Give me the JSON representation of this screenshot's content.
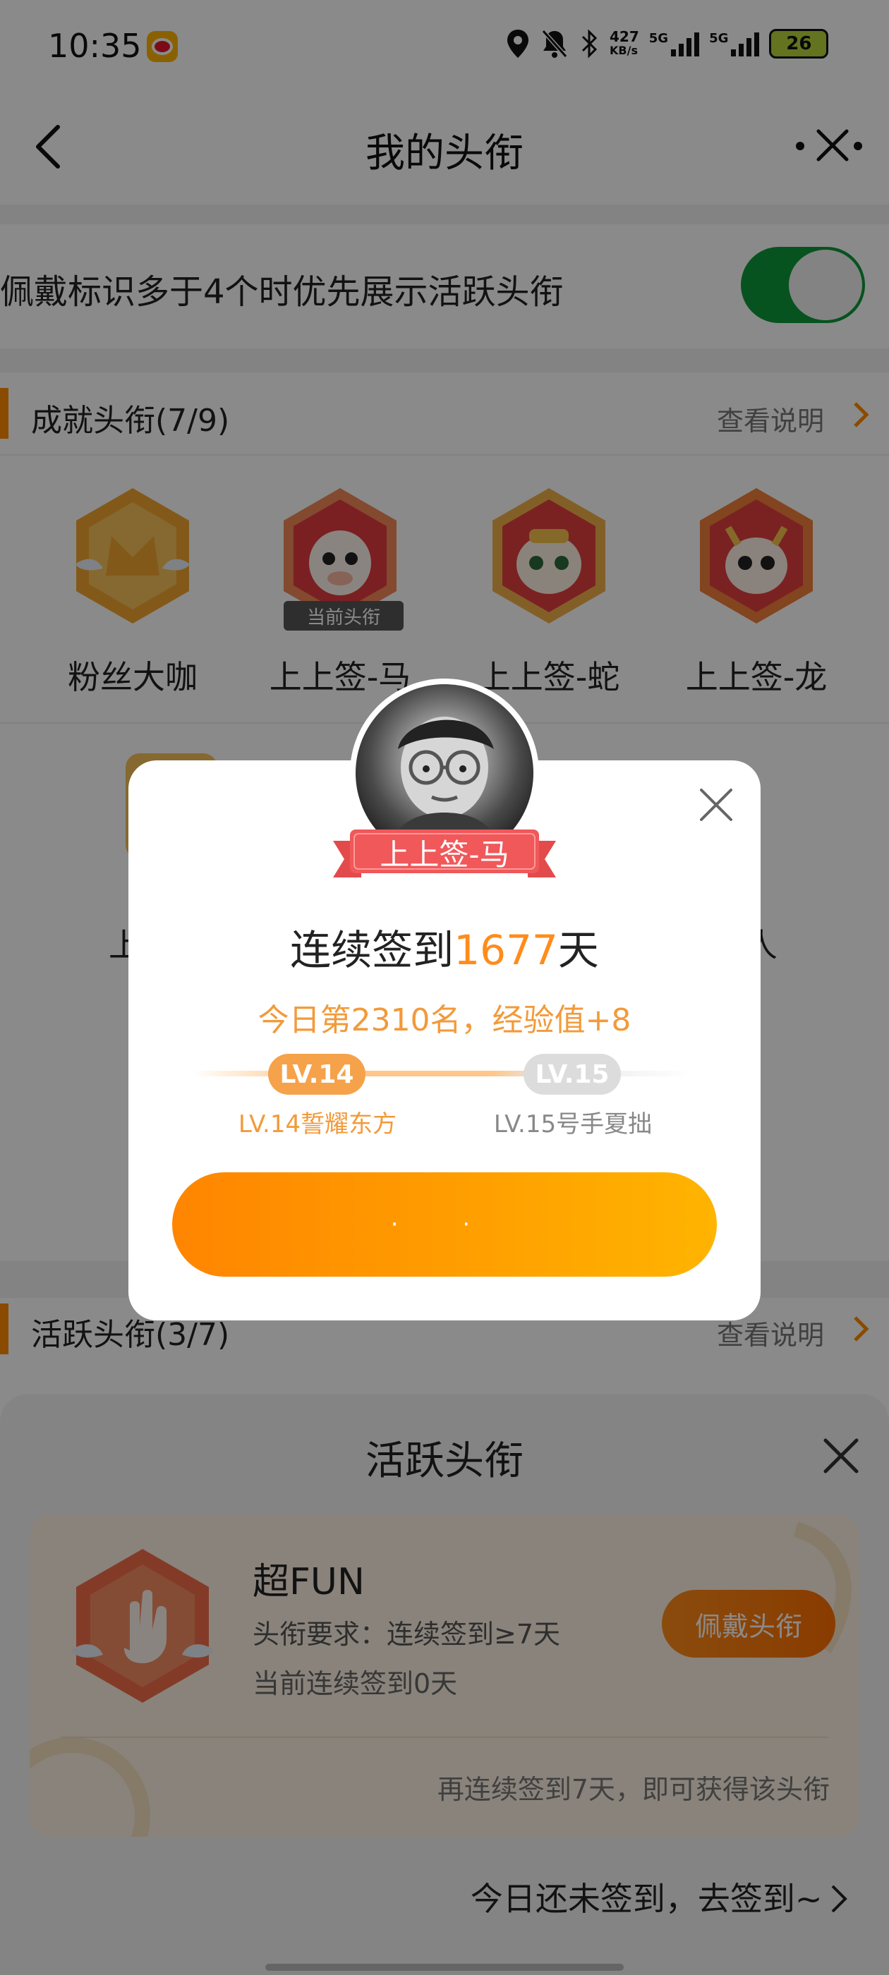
{
  "status_bar": {
    "time": "10:35",
    "net_speed_top": "427",
    "net_speed_unit": "KB/s",
    "sim1": "5G",
    "sim2": "5G",
    "battery": "26",
    "icons": [
      "weibo-icon",
      "location-icon",
      "mute-icon",
      "bluetooth-icon"
    ]
  },
  "nav": {
    "title": "我的头衔"
  },
  "settings": {
    "toggle_label": "佩戴标识多于4个时优先展示活跃头衔",
    "toggle_on": true
  },
  "achievement": {
    "title": "成就头衔(7/9)",
    "link": "查看说明",
    "current_tag": "当前头衔",
    "items": [
      {
        "label": "粉丝大咖"
      },
      {
        "label": "上上签-马"
      },
      {
        "label": "上上签-蛇"
      },
      {
        "label": "上上签-龙"
      }
    ],
    "row2_fragment_left": "上",
    "row2_fragment_right": "人"
  },
  "active": {
    "title": "活跃头衔(3/7)",
    "link": "查看说明"
  },
  "modal": {
    "badge_label": "上上签-马",
    "streak_prefix": "连续签到",
    "streak_days": "1677",
    "streak_suffix": "天",
    "rank_text": "今日第2310名，经验值+8",
    "level_current": "LV.14",
    "level_next": "LV.15",
    "level_current_name": "LV.14誓耀东方",
    "level_next_name": "LV.15号手夏拙",
    "level_progress": 0.6,
    "button_text": "· ·"
  },
  "sheet": {
    "title": "活跃头衔",
    "badge_name": "超FUN",
    "requirement": "头衔要求：连续签到≥7天",
    "current": "当前连续签到0天",
    "wear_button": "佩戴头衔",
    "hint": "再连续签到7天，即可获得该头衔",
    "go_sign": "今日还未签到，去签到~"
  },
  "colors": {
    "accent": "#ff8c1a",
    "toggle_on": "#0d9a3a",
    "ribbon": "#f0585a"
  }
}
